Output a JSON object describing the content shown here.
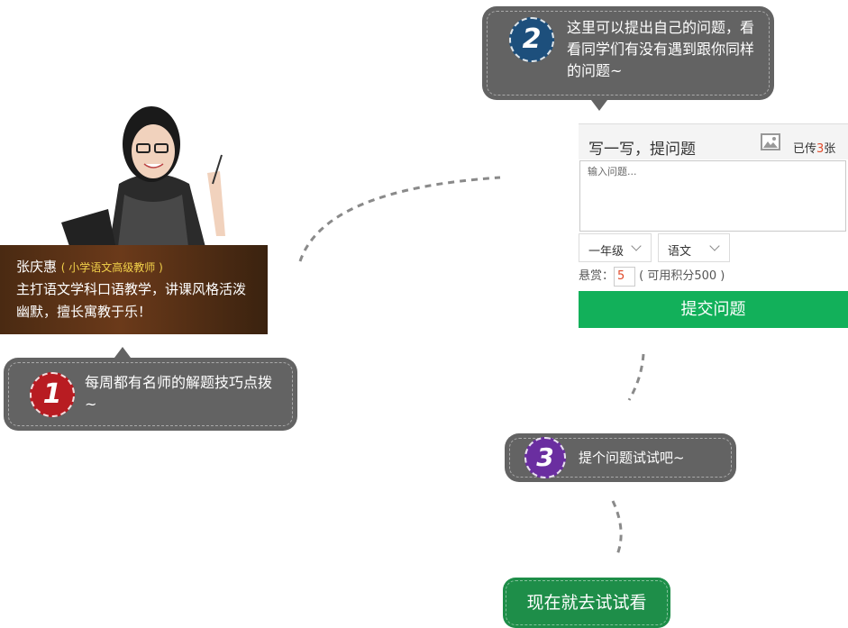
{
  "teacher": {
    "name": "张庆惠",
    "title": "( 小学语文高级教师 )",
    "description": "主打语文学科口语教学，讲课风格活泼幽默，擅长寓教于乐！"
  },
  "steps": [
    {
      "number": "1",
      "text": "每周都有名师的解题技巧点拨~",
      "color": "#b81c22"
    },
    {
      "number": "2",
      "text": "这里可以提出自己的问题，看看同学们有没有遇到跟你同样的问题~",
      "color": "#1d4f7c"
    },
    {
      "number": "3",
      "text": "提个问题试试吧~",
      "color": "#6a2ea0"
    }
  ],
  "ask_form": {
    "title": "写一写，提问题",
    "upload_prefix": "已传",
    "upload_count": "3",
    "upload_suffix": "张",
    "placeholder": "输入问题...",
    "grade": "一年级",
    "subject": "语文",
    "reward_label": "悬赏：",
    "reward_value": "5",
    "points_note": "( 可用积分500 )",
    "submit_label": "提交问题"
  },
  "cta": {
    "label": "现在就去试试看",
    "color": "#1e8e49"
  },
  "colors": {
    "bubble": "#636363",
    "submit": "#12b05a",
    "highlight": "#e04a2a"
  }
}
